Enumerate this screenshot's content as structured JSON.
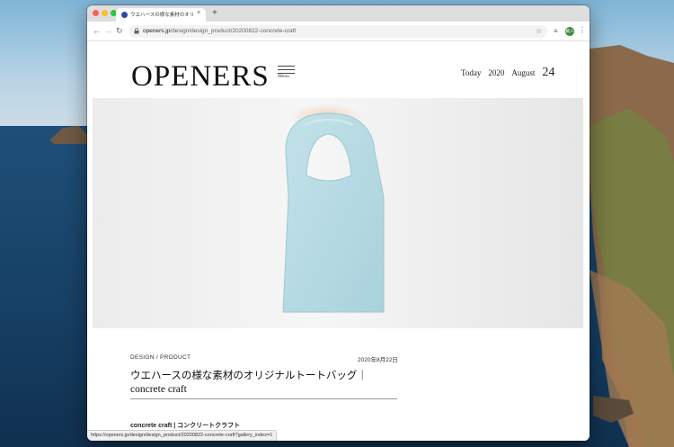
{
  "browser": {
    "tab_title": "ウエハースの様な素材のオリジナ",
    "tab_close": "×",
    "new_tab": "+",
    "url_host": "openers.jp",
    "url_path": "/design/design_product/20200822-concrete-craft",
    "profile_initials": "蔵人",
    "status_url": "https://openers.jp/design/design_product/20200822-concrete-craft?gallery_index=1"
  },
  "icons": {
    "back": "←",
    "forward": "→",
    "reload": "↻",
    "lock": "🔒",
    "star": "☆",
    "extension": "≡",
    "menu": "⋮"
  },
  "site": {
    "logo": "OPENERS",
    "menu_label": "Menu",
    "date_prefix": "Today",
    "date_year": "2020",
    "date_month": "August",
    "date_day": "24"
  },
  "article": {
    "category": "DESIGN / PRODUCT",
    "date": "2020年8月22日",
    "title": "ウエハースの様な素材のオリジナルトートバッグ｜concrete craft",
    "subtitle": "concrete craft | コンクリートクラフト"
  },
  "colors": {
    "bag": "#b8dbe4",
    "bag_shadow": "#9ec7d2",
    "accent_profile": "#3b8a3e"
  }
}
